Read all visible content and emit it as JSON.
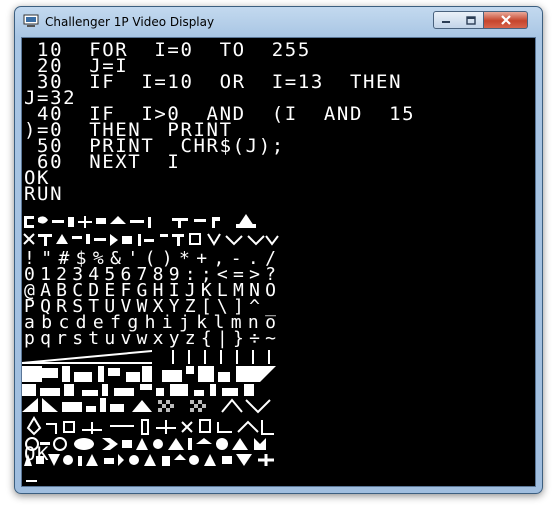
{
  "window": {
    "title": "Challenger 1P Video Display",
    "icons": {
      "app": "computer-icon",
      "minimize": "minimize-icon",
      "maximize": "maximize-icon",
      "close": "close-icon"
    },
    "colors": {
      "screen_bg": "#000000",
      "screen_fg": "#ffffff",
      "titlebar": "#a9c6e4",
      "close": "#c6452c"
    }
  },
  "screen": {
    "lines_top": [
      " 10  FOR  I=0  TO  255",
      " 20  J=I",
      " 30  IF  I=10  OR  I=13  THEN",
      "J=32",
      " 40  IF  I>0  AND  (I  AND  15",
      ")=0  THEN  PRINT",
      " 50  PRINT  CHR$(J);",
      " 60  NEXT  I",
      "OK",
      "RUN"
    ],
    "char_rows": [
      " !\"#$%&'()*+,-./",
      "0123456789:;<=>?",
      "@ABCDEFGHIJKLMNO",
      "PQRSTUVWXYZ[\\]^_",
      " abcdefghijklmno",
      "pqrstuvwxyz{|}÷~"
    ],
    "ok": "OK",
    "cursor": "_"
  }
}
